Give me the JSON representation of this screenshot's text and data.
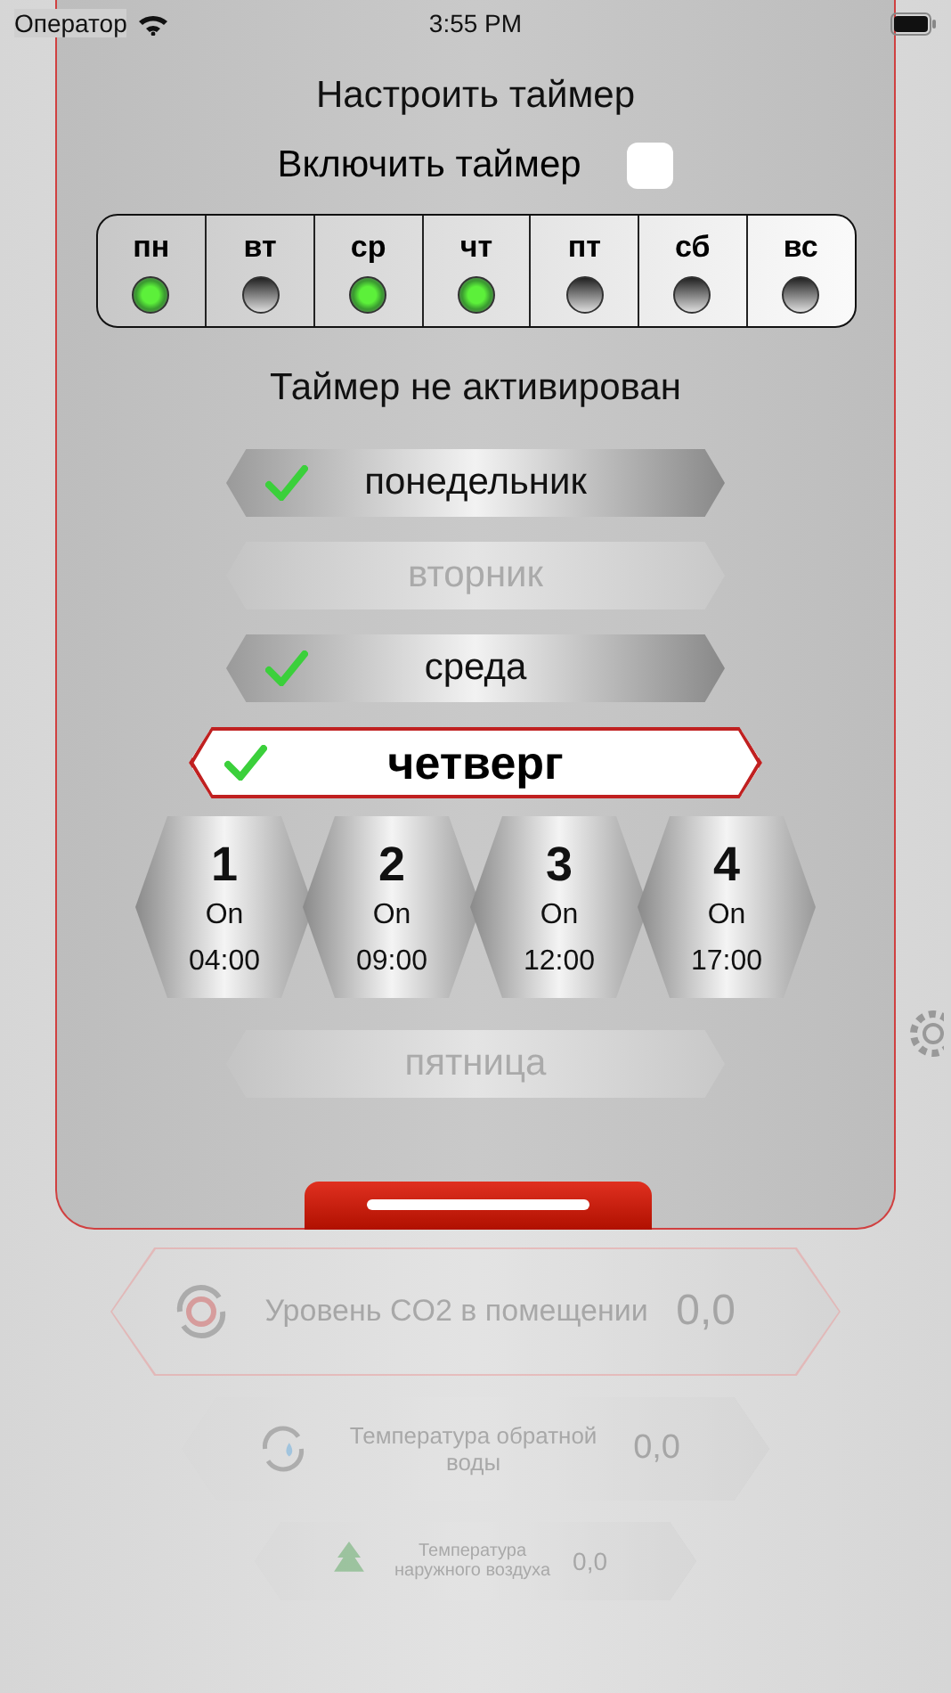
{
  "status_bar": {
    "carrier": "Оператор",
    "time": "3:55 PM"
  },
  "timer": {
    "title": "Настроить таймер",
    "enable_label": "Включить таймер",
    "enabled": false,
    "days": [
      {
        "label": "пн",
        "on": true
      },
      {
        "label": "вт",
        "on": false
      },
      {
        "label": "ср",
        "on": true
      },
      {
        "label": "чт",
        "on": true
      },
      {
        "label": "пт",
        "on": false
      },
      {
        "label": "сб",
        "on": false
      },
      {
        "label": "вс",
        "on": false
      }
    ],
    "status": "Таймер не активирован"
  },
  "day_list": [
    {
      "name": "понедельник",
      "checked": true,
      "disabled": false,
      "selected": false
    },
    {
      "name": "вторник",
      "checked": false,
      "disabled": true,
      "selected": false
    },
    {
      "name": "среда",
      "checked": true,
      "disabled": false,
      "selected": false
    },
    {
      "name": "четверг",
      "checked": true,
      "disabled": false,
      "selected": true,
      "slots": [
        {
          "number": "1",
          "state": "On",
          "time": "04:00"
        },
        {
          "number": "2",
          "state": "On",
          "time": "09:00"
        },
        {
          "number": "3",
          "state": "On",
          "time": "12:00"
        },
        {
          "number": "4",
          "state": "On",
          "time": "17:00"
        }
      ]
    },
    {
      "name": "пятница",
      "checked": false,
      "disabled": true,
      "selected": false
    }
  ],
  "sensors": [
    {
      "kind": "co2",
      "label": "Уровень CO2 в помещении",
      "value": "0,0"
    },
    {
      "kind": "water",
      "label": "Температура обратной воды",
      "value": "0,0"
    },
    {
      "kind": "air",
      "label": "Температура наружного воздуха",
      "value": "0,0"
    }
  ]
}
